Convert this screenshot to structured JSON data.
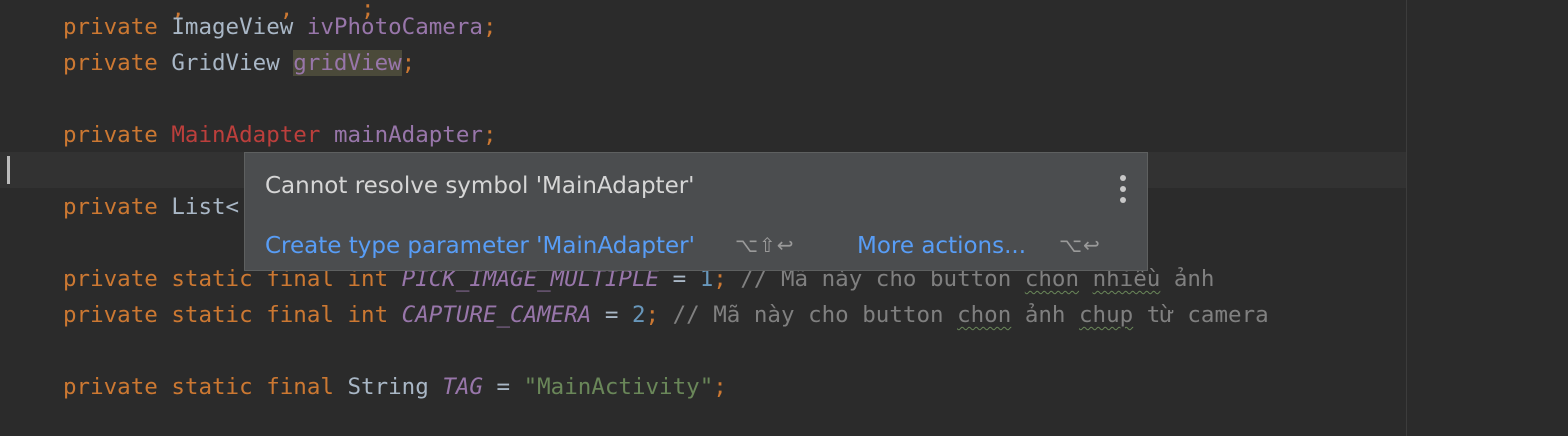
{
  "code_lines": [
    {
      "kw": "private",
      "type": "ImageView",
      "name": "ivPhotoCamera",
      "semi": ";"
    },
    {
      "kw": "private",
      "type": "GridView",
      "name": "gridView",
      "semi": ";"
    },
    {
      "kw": "private",
      "type": "MainAdapter",
      "name": "mainAdapter",
      "semi": ";"
    },
    {
      "kw": "private",
      "type": "List<"
    }
  ],
  "const_lines": [
    {
      "kw1": "private",
      "kw2": "static",
      "kw3": "final",
      "kw4": "int",
      "name": "PICK_IMAGE_MULTIPLE",
      "op": "=",
      "value": "1",
      "semi": ";",
      "comment_pre": "// Mã này cho button ",
      "comment_w1": "chon",
      "comment_mid": " ",
      "comment_w2": "nhiều",
      "comment_post": " ảnh"
    },
    {
      "kw1": "private",
      "kw2": "static",
      "kw3": "final",
      "kw4": "int",
      "name": "CAPTURE_CAMERA",
      "op": "=",
      "value": "2",
      "semi": ";",
      "comment_pre": "// Mã này cho button ",
      "comment_w1": "chon",
      "comment_mid": " ảnh ",
      "comment_w2": "chup",
      "comment_post": " từ camera"
    }
  ],
  "tag_line": {
    "kw1": "private",
    "kw2": "static",
    "kw3": "final",
    "type": "String",
    "name": "TAG",
    "op": "=",
    "value": "\"MainActivity\"",
    "semi": ";"
  },
  "popup": {
    "message": "Cannot resolve symbol 'MainAdapter'",
    "action1": "Create type parameter 'MainAdapter'",
    "action1_shortcut": "⌥⇧↩",
    "action2": "More actions...",
    "action2_shortcut": "⌥↩"
  },
  "colors": {
    "background": "#2b2b2b",
    "keyword": "#cc7832",
    "field": "#9876aa",
    "unresolved": "#bc3f3c",
    "number": "#6897bb",
    "string": "#6a8759",
    "comment": "#808080",
    "link": "#589df6"
  }
}
